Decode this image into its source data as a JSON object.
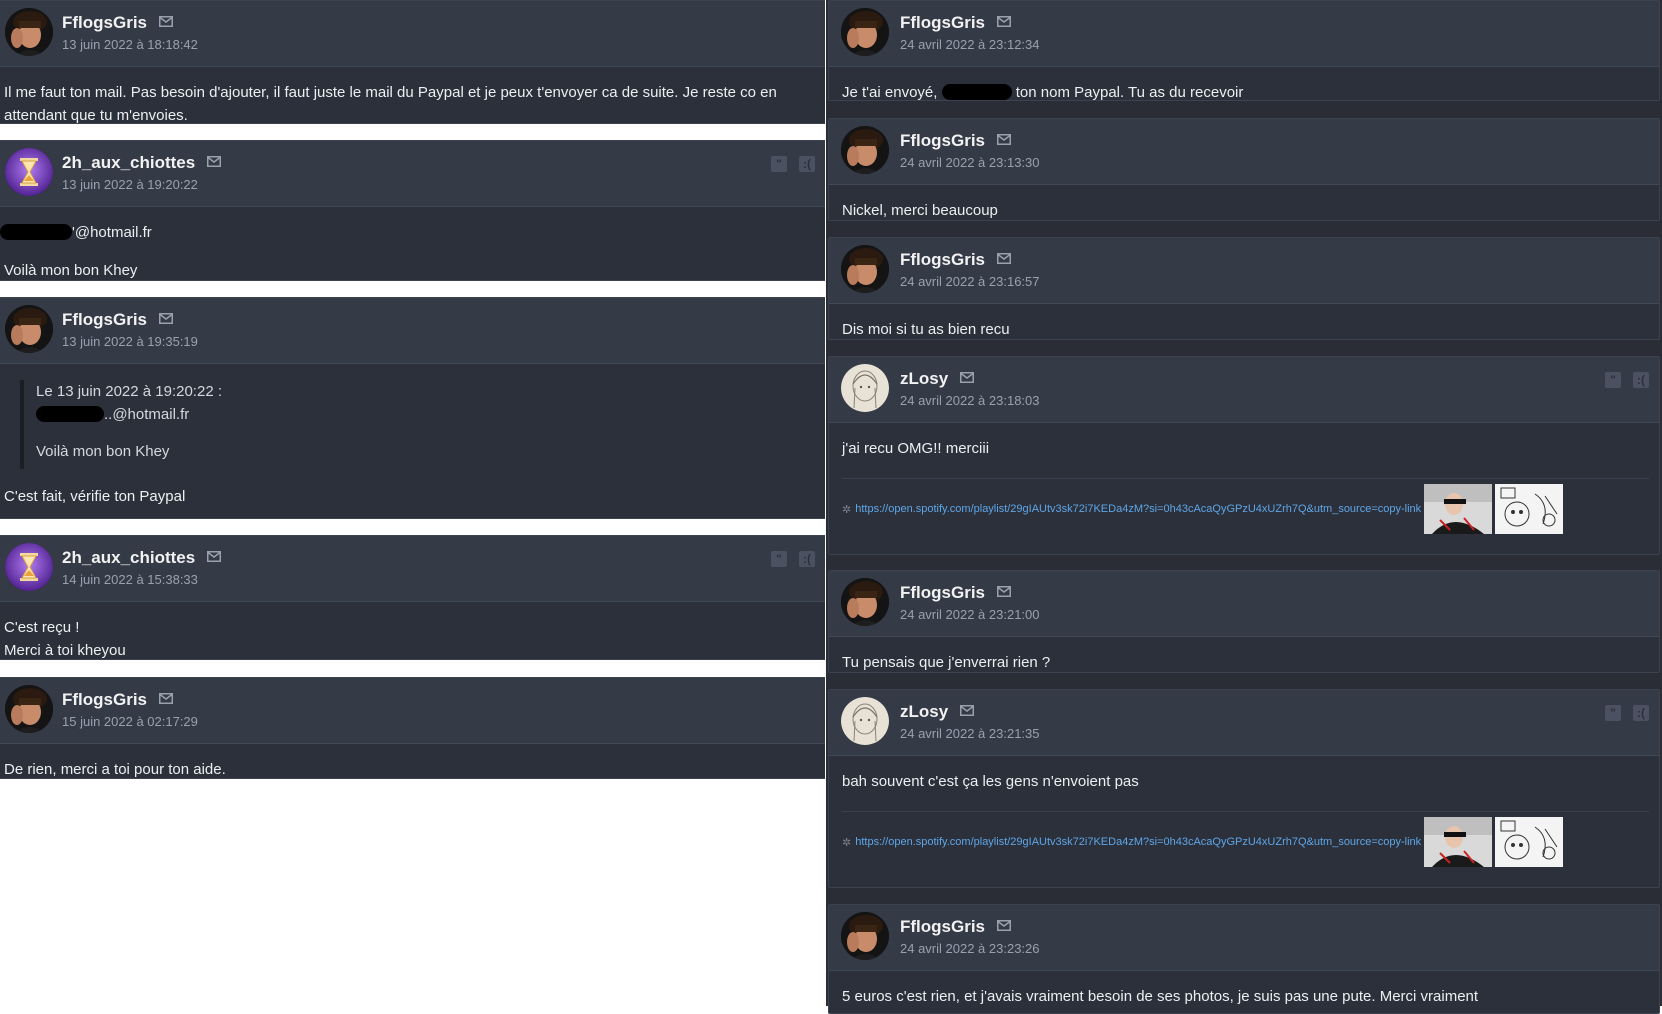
{
  "left": {
    "posts": [
      {
        "pseudo": "FflogsGris",
        "date": "13 juin 2022 à 18:18:42",
        "lines": [
          "Il me faut ton mail. Pas besoin d'ajouter, il faut juste le mail du Paypal et je peux t'envoyer ca de suite. Je reste co en attendant que tu m'envoies."
        ]
      },
      {
        "pseudo": "2h_aux_chiottes",
        "date": "13 juin 2022 à 19:20:22",
        "email_suffix": "'@hotmail.fr",
        "line2": "Voilà mon bon Khey"
      },
      {
        "pseudo": "FflogsGris",
        "date": "13 juin 2022 à 19:35:19",
        "quote_header": "Le 13 juin 2022 à 19:20:22 :",
        "quote_email": "..@hotmail.fr",
        "quote_line": "Voilà mon bon Khey",
        "line": "C'est fait, vérifie ton Paypal"
      },
      {
        "pseudo": "2h_aux_chiottes",
        "date": "14 juin 2022 à 15:38:33",
        "line1": "C'est reçu !",
        "line2": "Merci à toi kheyou"
      },
      {
        "pseudo": "FflogsGris",
        "date": "15 juin 2022 à 02:17:29",
        "line": "De rien, merci a toi pour ton aide."
      }
    ]
  },
  "right": {
    "posts": [
      {
        "pseudo": "FflogsGris",
        "date": "24 avril 2022 à 23:12:34",
        "line_a": "Je t'ai envoyé, ",
        "line_b": " ton nom Paypal. Tu as du recevoir"
      },
      {
        "pseudo": "FflogsGris",
        "date": "24 avril 2022 à 23:13:30",
        "line": "Nickel, merci beaucoup"
      },
      {
        "pseudo": "FflogsGris",
        "date": "24 avril 2022 à 23:16:57",
        "line": "Dis moi si tu as bien recu"
      },
      {
        "pseudo": "zLosy",
        "date": "24 avril 2022 à 23:18:03",
        "line": "j'ai recu OMG!! merciii",
        "link": "https://open.spotify.com/playlist/29gIAUtv3sk72i7KEDa4zM?si=0h43cAcaQyGPzU4xUZrh7Q&utm_source=copy-link"
      },
      {
        "pseudo": "FflogsGris",
        "date": "24 avril 2022 à 23:21:00",
        "line": "Tu pensais que j'enverrai rien ?"
      },
      {
        "pseudo": "zLosy",
        "date": "24 avril 2022 à 23:21:35",
        "line": "bah souvent c'est ça les gens n'envoient pas",
        "link": "https://open.spotify.com/playlist/29gIAUtv3sk72i7KEDa4zM?si=0h43cAcaQyGPzU4xUZrh7Q&utm_source=copy-link"
      },
      {
        "pseudo": "FflogsGris",
        "date": "24 avril 2022 à 23:23:26",
        "line": "5 euros c'est rien, et j'avais vraiment besoin de ses photos, je suis pas une pute. Merci vraiment"
      }
    ]
  },
  "icons": {
    "mail": "mail-icon",
    "quote": "quote-icon",
    "report": "report-icon",
    "spotify": "spotify-star-icon"
  },
  "colors": {
    "background": "#2c303a",
    "header": "#353a47",
    "link": "#5ea6e8"
  }
}
